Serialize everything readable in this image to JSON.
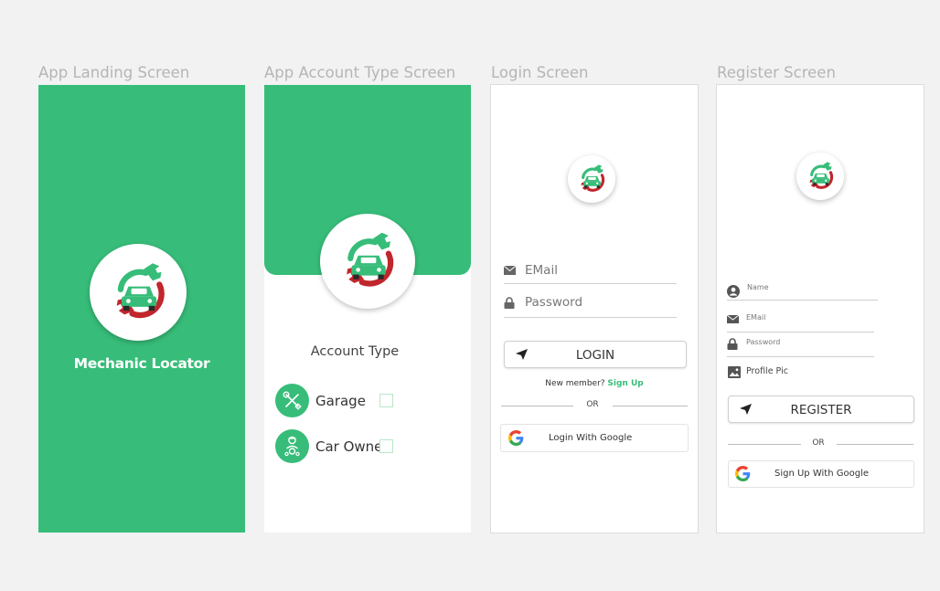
{
  "colors": {
    "brand_green": "#37bd79",
    "logo_red": "#c0262c",
    "link_green": "#37bd79"
  },
  "landing": {
    "screen_title": "App Landing Screen",
    "app_name": "Mechanic Locator",
    "logo_icon": "car-wrench-logo-icon"
  },
  "account_type": {
    "screen_title": "App Account Type Screen",
    "heading": "Account Type",
    "options": [
      {
        "label": "Garage",
        "icon": "tools-icon",
        "checked": false
      },
      {
        "label": "Car Owner",
        "icon": "driver-icon",
        "checked": false
      }
    ]
  },
  "login": {
    "screen_title": "Login Screen",
    "email_placeholder": "EMail",
    "password_placeholder": "Password",
    "login_button": "LOGIN",
    "new_member_text": "New member?",
    "sign_up_link": "Sign Up",
    "or_text": "OR",
    "google_button": "Login With Google"
  },
  "register": {
    "screen_title": "Register Screen",
    "name_placeholder": "Name",
    "email_placeholder": "EMail",
    "password_placeholder": "Password",
    "profile_pic_label": "Profile Pic",
    "register_button": "REGISTER",
    "or_text": "OR",
    "google_button": "Sign Up With Google"
  }
}
